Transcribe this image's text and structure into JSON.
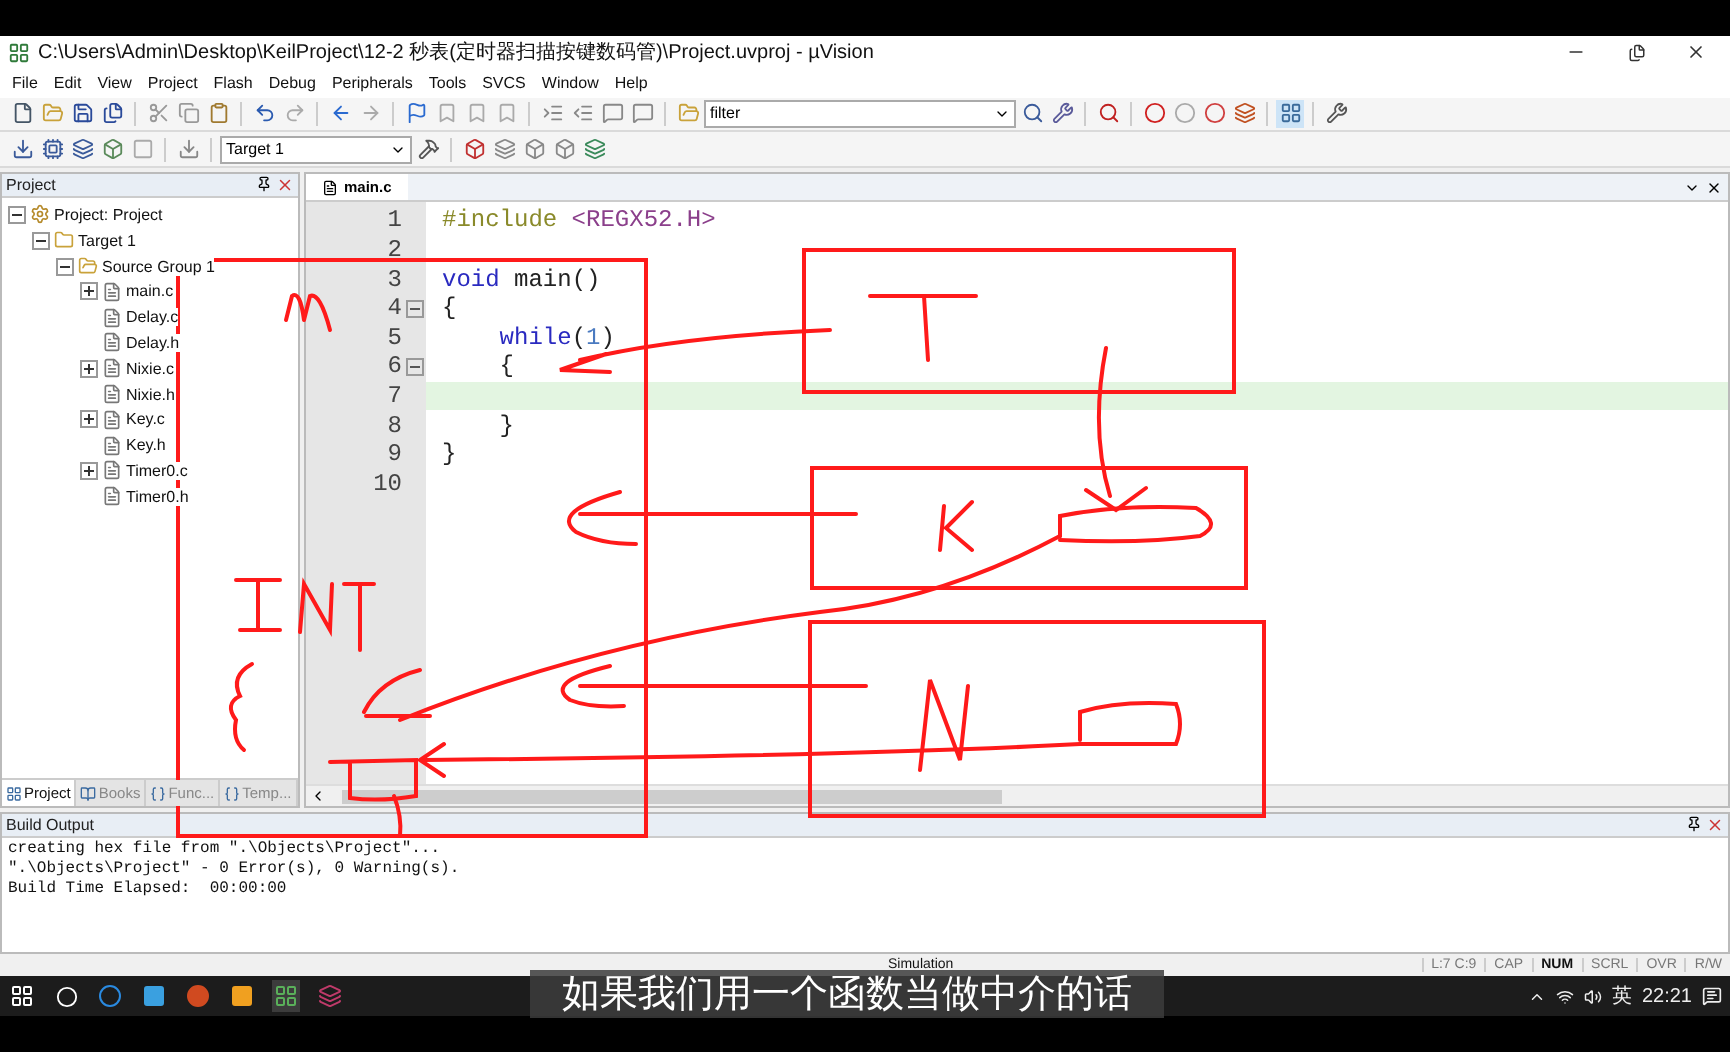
{
  "window": {
    "title": "C:\\Users\\Admin\\Desktop\\KeilProject\\12-2 秒表(定时器扫描按键数码管)\\Project.uvproj - µVision"
  },
  "menu": [
    "File",
    "Edit",
    "View",
    "Project",
    "Flash",
    "Debug",
    "Peripherals",
    "Tools",
    "SVCS",
    "Window",
    "Help"
  ],
  "toolbar": {
    "find_field": {
      "value": "filter"
    },
    "target_select": {
      "value": "Target 1"
    }
  },
  "project_panel": {
    "title": "Project",
    "tree": [
      {
        "label": "Project: Project",
        "kind": "project",
        "expanded": true,
        "children": [
          {
            "label": "Target 1",
            "kind": "target",
            "expanded": true,
            "children": [
              {
                "label": "Source Group 1",
                "kind": "group",
                "expanded": true,
                "children": [
                  {
                    "label": "main.c",
                    "kind": "file",
                    "expanded": false
                  },
                  {
                    "label": "Delay.c",
                    "kind": "file"
                  },
                  {
                    "label": "Delay.h",
                    "kind": "file"
                  },
                  {
                    "label": "Nixie.c",
                    "kind": "file",
                    "expanded": false
                  },
                  {
                    "label": "Nixie.h",
                    "kind": "file"
                  },
                  {
                    "label": "Key.c",
                    "kind": "file",
                    "expanded": false
                  },
                  {
                    "label": "Key.h",
                    "kind": "file"
                  },
                  {
                    "label": "Timer0.c",
                    "kind": "file",
                    "expanded": false
                  },
                  {
                    "label": "Timer0.h",
                    "kind": "file"
                  }
                ]
              }
            ]
          }
        ]
      }
    ],
    "tabs": [
      {
        "label": "Project",
        "selected": true
      },
      {
        "label": "Books",
        "selected": false
      },
      {
        "label": "Func...",
        "selected": false
      },
      {
        "label": "Temp...",
        "selected": false
      }
    ]
  },
  "editor": {
    "tab": "main.c",
    "lines": [
      {
        "number": "1",
        "segments": [
          {
            "kind": "directive",
            "text": "#include"
          },
          {
            "kind": "header",
            "text": " <REGX52.H>"
          }
        ]
      },
      {
        "number": "2"
      },
      {
        "number": "3",
        "segments": [
          {
            "kind": "keyword",
            "text": "void"
          },
          {
            "kind": "plain",
            "text": " main()"
          }
        ]
      },
      {
        "number": "4",
        "fold": true,
        "segments": [
          {
            "kind": "plain",
            "text": "{"
          }
        ]
      },
      {
        "number": "5",
        "segments": [
          {
            "kind": "keyword",
            "text": "    while"
          },
          {
            "kind": "plain",
            "text": "("
          },
          {
            "kind": "number",
            "text": "1"
          },
          {
            "kind": "plain",
            "text": ")"
          }
        ]
      },
      {
        "number": "6",
        "fold": true,
        "segments": [
          {
            "kind": "plain",
            "text": "    {"
          }
        ]
      },
      {
        "number": "7",
        "current": true
      },
      {
        "number": "8",
        "segments": [
          {
            "kind": "plain",
            "text": "    }"
          }
        ]
      },
      {
        "number": "9",
        "segments": [
          {
            "kind": "plain",
            "text": "}"
          }
        ]
      },
      {
        "number": "10"
      }
    ]
  },
  "build_output": {
    "title": "Build Output",
    "lines": [
      "creating hex file from \".\\Objects\\Project\"...",
      "\".\\Objects\\Project\" - 0 Error(s), 0 Warning(s).",
      "Build Time Elapsed:  00:00:00"
    ]
  },
  "status_bar": {
    "mode": "Simulation",
    "position": "L:7 C:9",
    "indicators": [
      {
        "label": "CAP",
        "on": false
      },
      {
        "label": "NUM",
        "on": true
      },
      {
        "label": "SCRL",
        "on": false
      },
      {
        "label": "OVR",
        "on": false
      },
      {
        "label": "R/W",
        "on": false
      }
    ]
  },
  "taskbar": {
    "input_method": "英",
    "time": "22:21"
  },
  "subtitle": "如果我们用一个函数当做中介的话"
}
